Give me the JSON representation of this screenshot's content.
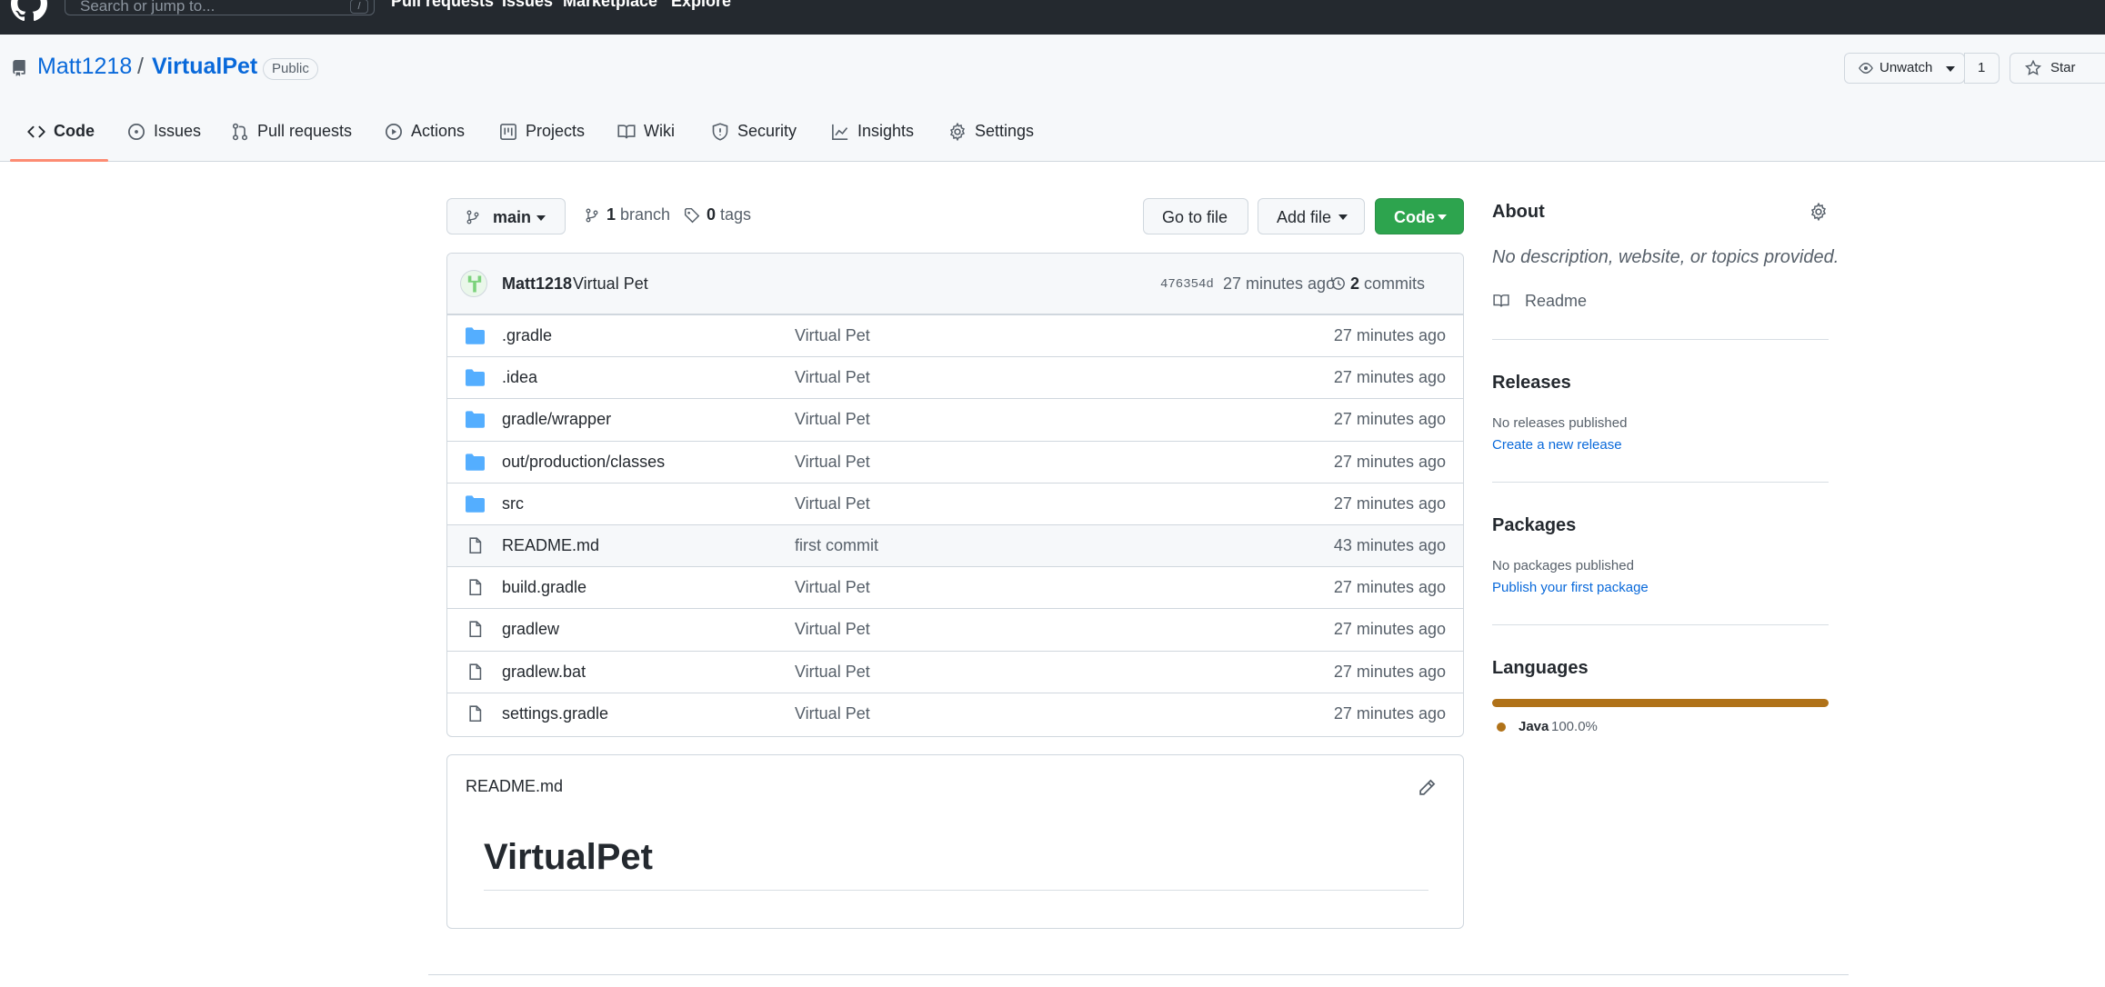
{
  "topbar": {
    "search_placeholder": "Search or jump to...",
    "search_key": "/",
    "nav": [
      "Pull requests",
      "Issues",
      "Marketplace",
      "Explore"
    ]
  },
  "repo": {
    "owner": "Matt1218",
    "separator": "/",
    "name": "VirtualPet",
    "visibility": "Public",
    "unwatch_label": "Unwatch",
    "watch_count": "1",
    "star_label": "Star"
  },
  "tabs": [
    {
      "label": "Code",
      "icon": "code-icon"
    },
    {
      "label": "Issues",
      "icon": "issue-icon"
    },
    {
      "label": "Pull requests",
      "icon": "pull-request-icon"
    },
    {
      "label": "Actions",
      "icon": "play-icon"
    },
    {
      "label": "Projects",
      "icon": "project-icon"
    },
    {
      "label": "Wiki",
      "icon": "book-icon"
    },
    {
      "label": "Security",
      "icon": "shield-icon"
    },
    {
      "label": "Insights",
      "icon": "graph-icon"
    },
    {
      "label": "Settings",
      "icon": "gear-icon"
    }
  ],
  "toolbar": {
    "branch": "main",
    "branch_count": "1",
    "branch_word": "branch",
    "tag_count": "0",
    "tag_word": "tags",
    "go_to_file": "Go to file",
    "add_file": "Add file",
    "code": "Code"
  },
  "latest_commit": {
    "author": "Matt1218",
    "message": "Virtual Pet",
    "sha": "476354d",
    "age": "27 minutes ago",
    "commit_count": "2",
    "commit_word": "commits"
  },
  "files": [
    {
      "name": ".gradle",
      "type": "dir",
      "message": "Virtual Pet",
      "age": "27 minutes ago"
    },
    {
      "name": ".idea",
      "type": "dir",
      "message": "Virtual Pet",
      "age": "27 minutes ago"
    },
    {
      "name": "gradle/wrapper",
      "type": "dir",
      "message": "Virtual Pet",
      "age": "27 minutes ago"
    },
    {
      "name": "out/production/classes",
      "type": "dir",
      "message": "Virtual Pet",
      "age": "27 minutes ago"
    },
    {
      "name": "src",
      "type": "dir",
      "message": "Virtual Pet",
      "age": "27 minutes ago"
    },
    {
      "name": "README.md",
      "type": "file",
      "message": "first commit",
      "age": "43 minutes ago"
    },
    {
      "name": "build.gradle",
      "type": "file",
      "message": "Virtual Pet",
      "age": "27 minutes ago"
    },
    {
      "name": "gradlew",
      "type": "file",
      "message": "Virtual Pet",
      "age": "27 minutes ago"
    },
    {
      "name": "gradlew.bat",
      "type": "file",
      "message": "Virtual Pet",
      "age": "27 minutes ago"
    },
    {
      "name": "settings.gradle",
      "type": "file",
      "message": "Virtual Pet",
      "age": "27 minutes ago"
    }
  ],
  "readme": {
    "filename": "README.md",
    "heading": "VirtualPet"
  },
  "sidebar": {
    "about_title": "About",
    "about_desc": "No description, website, or topics provided.",
    "readme_label": "Readme",
    "releases_title": "Releases",
    "releases_none": "No releases published",
    "releases_link": "Create a new release",
    "packages_title": "Packages",
    "packages_none": "No packages published",
    "packages_link": "Publish your first package",
    "languages_title": "Languages",
    "languages": [
      {
        "name": "Java",
        "percent": "100.0%",
        "fraction": 1.0,
        "color": "#b07219"
      }
    ]
  },
  "colors": {
    "accent": "#0969da",
    "green": "#2da44e",
    "folder": "#54aeff",
    "tab_underline": "#fd8c73"
  }
}
